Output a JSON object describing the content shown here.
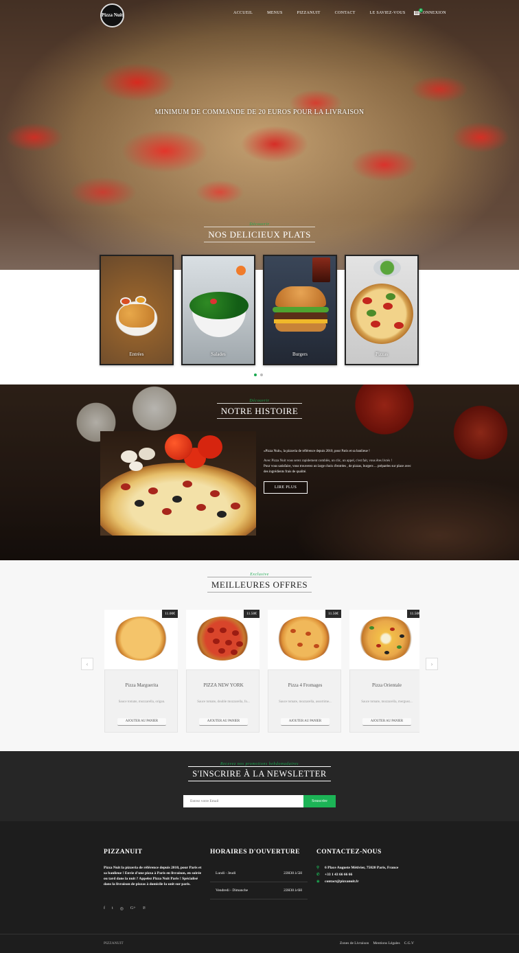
{
  "nav": {
    "logo_text": "Pizza Nuit",
    "items": [
      "ACCUEIL",
      "MENUS",
      "PIZZANUIT",
      "CONTACT",
      "LE SAVIEZ-VOUS",
      "CONNEXION"
    ],
    "cart_count": "0"
  },
  "hero": {
    "text": "MINIMUM DE COMMANDE DE 20 EUROS POUR LA LIVRAISON"
  },
  "plats": {
    "kicker": "Découvrir",
    "title": "NOS DELICIEUX PLATS",
    "items": [
      "Entrées",
      "Salades",
      "Burgers",
      "Pizzas"
    ]
  },
  "histoire": {
    "kicker": "Découvrir",
    "title": "NOTRE HISTOIRE",
    "p1": "«Pizza Nuit», la pizzeria de référence depuis 2010, pour Paris et sa banlieue !",
    "p2": "Avec Pizza Nuit vous serez rapidement comblés, un clic, un appel, c'est fait, vous êtes livrés !",
    "p3": "Pour vous satisfaire, vous trouverez un large choix d'entrées , de pizzas, burgers ... préparées sur place avec des ingrédients frais de qualité.",
    "button": "LIRE PLUS"
  },
  "offres": {
    "kicker": "Exclusive",
    "title": "MEILLEURES OFFRES",
    "prev": "‹",
    "next": "›",
    "items": [
      {
        "price": "11.00€",
        "name": "Pizza Marguerita",
        "desc": "Sauce tomate, mozzarella, origan.",
        "button": "AJOUTER AU PANIER"
      },
      {
        "price": "11.50€",
        "name": "PIZZA NEW YORK",
        "desc": "Sauce tomate, double mozzarella, fo...",
        "button": "AJOUTER AU PANIER"
      },
      {
        "price": "11.50€",
        "name": "Pizza 4 Fromages",
        "desc": "Sauce tomate, mozzarella, assortime...",
        "button": "AJOUTER AU PANIER"
      },
      {
        "price": "11.50€",
        "name": "Pizza Orientale",
        "desc": "Sauce tomate, mozzarella, merguez...",
        "button": "AJOUTER AU PANIER"
      }
    ]
  },
  "newsletter": {
    "kicker": "Recevez nos promotions hebdomadaires",
    "title": "S'INSCRIRE À LA NEWSLETTER",
    "placeholder": "Entrez votre Email",
    "button": "Souscrire"
  },
  "footer": {
    "about_title": "PIZZANUIT",
    "about_text": "Pizza Nuit la pizzeria de référence depuis 2010, pour Paris et sa banlieue ! Envie d'une pizza à Paris en livraison, en soirée ou tard dans la nuit ? Appelez Pizza Nuit Paris ! Spécialisé dans la livraison de pizzas à domicile la unit sur paris.",
    "socials": [
      "f",
      "t",
      "◎",
      "G+",
      "℗"
    ],
    "hours_title": "HORAIRES D'OUVERTURE",
    "hours": [
      {
        "days": "Lundi - Jeudi",
        "time": "22H30 à 5H"
      },
      {
        "days": "Vendredi - Dimanche",
        "time": "22H30 à 6H"
      }
    ],
    "contact_title": "CONTACTEZ-NOUS",
    "address": "6 Place Auguste Métivier, 75020 Paris, France",
    "phone": "+33 1 43 66 66 66",
    "email": "contact@pizzanuit.fr",
    "bottom_left": "PIZZANUIT",
    "bottom_links": [
      "Zones de Livraison",
      "Mentions Légales",
      "C.G.V"
    ]
  },
  "colors": {
    "accent": "#1cb456",
    "dark": "#262626"
  }
}
